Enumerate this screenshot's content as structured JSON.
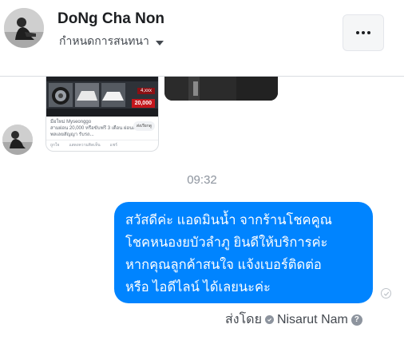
{
  "header": {
    "contact_name": "DoNg Cha Non",
    "subtitle": "กำหนดการสนทนา",
    "avatar_icon": "user-avatar",
    "more_icon": "more-options-icon"
  },
  "shared_card": {
    "price_small": "4,xxx",
    "price": "20,000",
    "text_line1": "มือใหม่ Myseonggo",
    "text_line2": "สามผ่อน 20,000 หรือขับฟรี 3 เดือน ผ่อนเริ่ม 4,xxx พลเลยสัญญา รับรถ...",
    "save_label": "ส่งเรียกดู",
    "actions": [
      "ถูกใจ",
      "แสดงความคิดเห็น",
      "แชร์"
    ]
  },
  "timestamp": "09:32",
  "message": {
    "lines": [
      "สวัสดีค่ะ แอดมินน้ำ จากร้านโชคคูณ",
      "โชคหนองยบัวลำภู ยินดีให้บริการค่ะ",
      "หากคุณลูกค้าสนใจ แจ้งเบอร์ติดต่อ",
      "หรือ ไอดีไลน์ ได้เลยนะค่ะ"
    ],
    "bubble_color": "#0084ff"
  },
  "footer": {
    "sent_by_label": "ส่งโดย",
    "sender": "Nisarut Nam",
    "help": "?"
  }
}
